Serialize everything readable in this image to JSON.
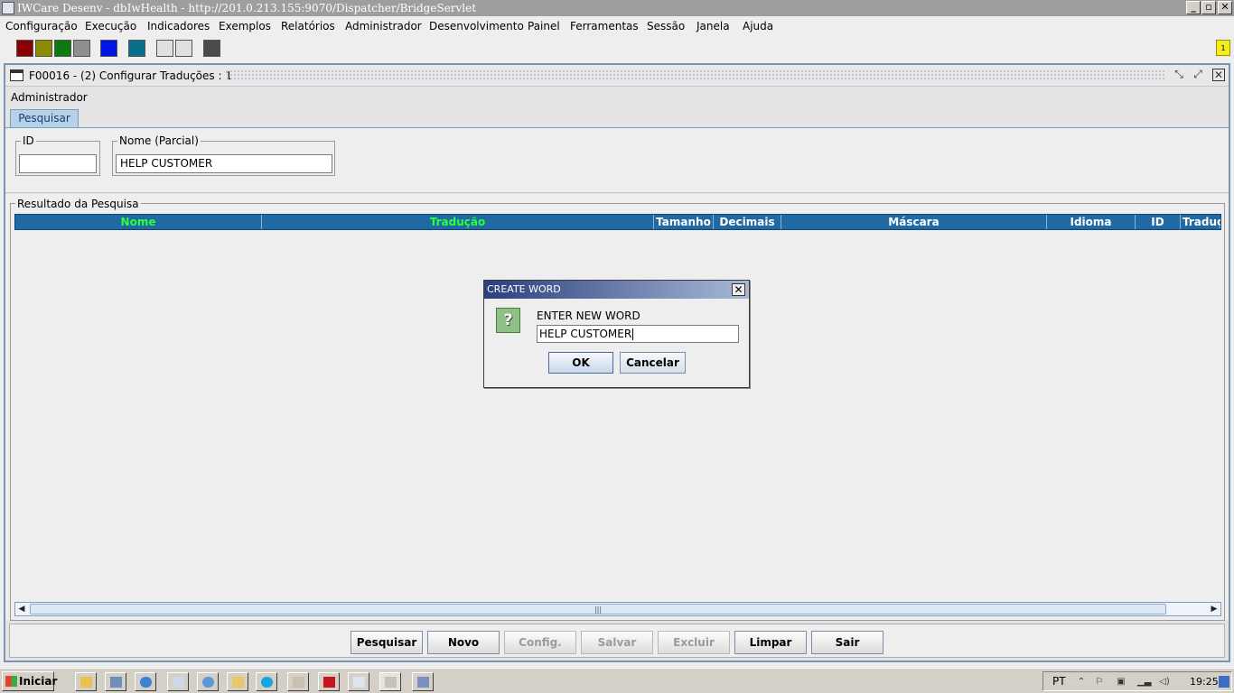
{
  "window": {
    "title": "IWCare Desenv - dbIwHealth - http://201.0.213.155:9070/Dispatcher/BridgeServlet",
    "minimize": "_",
    "maximize": "▫",
    "close": "✕"
  },
  "menu": [
    "Configuração",
    "Execução",
    "Indicadores",
    "Exemplos",
    "Relatórios",
    "Administrador",
    "Desenvolvimento",
    "Painel",
    "Ferramentas",
    "Sessão",
    "Janela",
    "Ajuda"
  ],
  "toolbar": {
    "colors": [
      "#8b0000",
      "#8c8c00",
      "#0c7a0c",
      "#8e8e8e",
      "#0014e6",
      "#0a6f8c",
      "#e0e0e0",
      "#e0e0e0",
      "#4a4a4a"
    ],
    "notification_count": "1"
  },
  "inner_window": {
    "title": "F00016 - (2) Configurar Traduções : 1",
    "user_label": "Administrador",
    "tab": "Pesquisar"
  },
  "search": {
    "id_label": "ID",
    "id_value": "",
    "nome_label": "Nome (Parcial)",
    "nome_value": "HELP CUSTOMER"
  },
  "results": {
    "legend": "Resultado da Pesquisa",
    "columns": [
      "Nome",
      "Tradução",
      "Tamanho",
      "Decimais",
      "Máscara",
      "Idioma",
      "ID",
      "Traduç"
    ]
  },
  "buttons": {
    "pesquisar": "Pesquisar",
    "novo": "Novo",
    "config": "Config.",
    "salvar": "Salvar",
    "excluir": "Excluir",
    "limpar": "Limpar",
    "sair": "Sair"
  },
  "dialog": {
    "title": "CREATE WORD",
    "close": "✕",
    "icon": "?",
    "prompt": "ENTER NEW WORD",
    "value": "HELP CUSTOMER",
    "ok": "OK",
    "cancel": "Cancelar"
  },
  "taskbar": {
    "start": "Iniciar",
    "language": "PT",
    "clock": "19:25"
  }
}
